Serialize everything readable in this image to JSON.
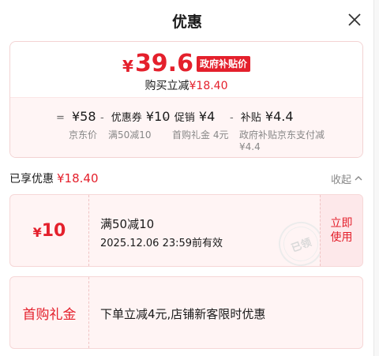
{
  "header": {
    "title": "优惠"
  },
  "price": {
    "currency": "¥",
    "value": "39.6",
    "badge": "政府补贴价",
    "save_label": "购买立减",
    "save_amount": "¥18.40"
  },
  "breakdown": [
    {
      "op": "=",
      "name": "",
      "value": "¥58",
      "sub": "京东价"
    },
    {
      "op": "-",
      "name": "优惠券",
      "value": "¥10",
      "sub": "满50减10"
    },
    {
      "op": "-",
      "name": "促销",
      "value": "¥4",
      "sub": "首购礼金 4元"
    },
    {
      "op": "-",
      "name": "补贴",
      "value": "¥4.4",
      "sub": "政府补贴京东支付减¥4.4"
    }
  ],
  "enjoyed": {
    "label": "已享优惠",
    "amount": "¥18.40",
    "collapse_label": "收起"
  },
  "coupon": {
    "amount_symbol": "¥",
    "amount": "10",
    "title": "满50减10",
    "valid": "2025.12.06 23:59前有效",
    "action_line1": "立即",
    "action_line2": "使用",
    "stamp": "已领"
  },
  "gift": {
    "name": "首购礼金",
    "description": "下单立减4元,店铺新客限时优惠"
  },
  "colors": {
    "accent": "#e4202c",
    "card_bg": "#fff4f4"
  }
}
